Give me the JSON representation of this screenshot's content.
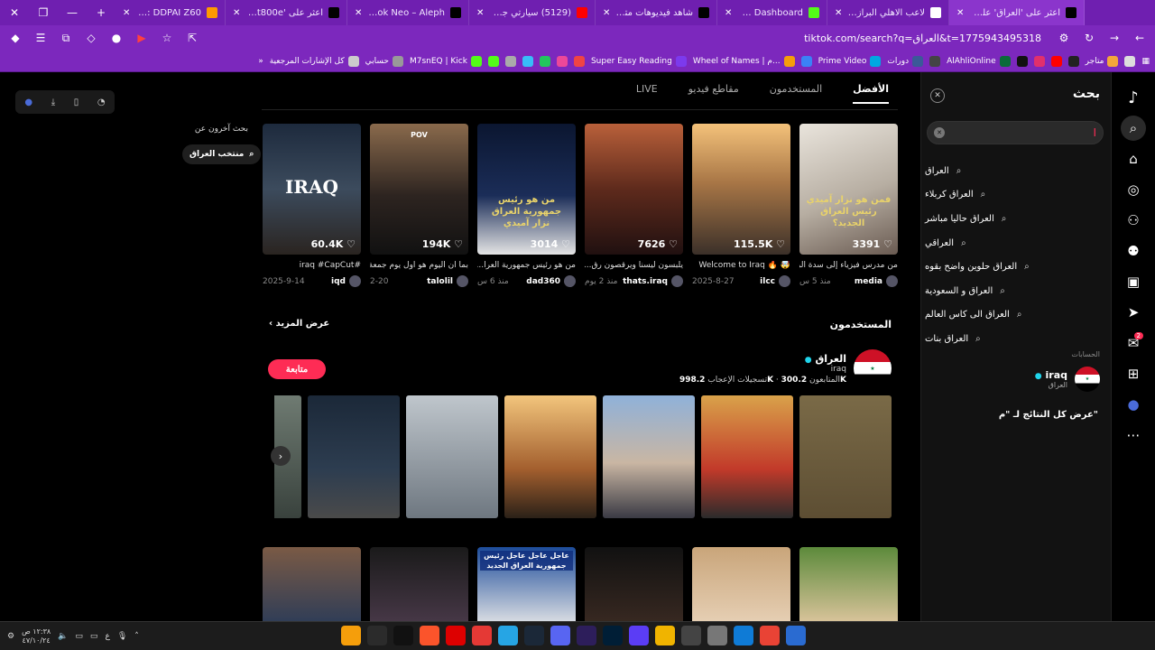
{
  "browser": {
    "tabs": [
      {
        "title": "Amazon.sa : DDPAI Z60",
        "fav": "#ff9900",
        "active": false
      },
      {
        "title": "اعثر على '70mai t800e'",
        "fav": "#010101",
        "active": false
      },
      {
        "title": "MacBook Neo – Aleph ف",
        "fav": "#000000",
        "active": false
      },
      {
        "title": "(5129) سيارتي جديدة!!😍",
        "fav": "#ff0000",
        "active": false
      },
      {
        "title": "شاهد فيديوهات متصدرة |",
        "fav": "#010101",
        "active": false
      },
      {
        "title": "VODs - Kick Dashboard",
        "fav": "#53fc18",
        "active": false
      },
      {
        "title": "لاعب الاهلي البرازيلي السا",
        "fav": "#ffffff",
        "active": false
      },
      {
        "title": "اعثر على 'العراق' على TikTok",
        "fav": "#010101",
        "active": true
      }
    ],
    "url": "tiktok.com/search?q=العراق&t=1775943495318",
    "bookmarks": [
      {
        "label": "",
        "color": "#dddddd"
      },
      {
        "label": "متاجر",
        "color": "#f4a63a"
      },
      {
        "label": "",
        "color": "#222222"
      },
      {
        "label": "",
        "color": "#ff0000"
      },
      {
        "label": "",
        "color": "#e1306c"
      },
      {
        "label": "",
        "color": "#111111"
      },
      {
        "label": "AlAhliOnline",
        "color": "#0a6b3a"
      },
      {
        "label": "",
        "color": "#444444"
      },
      {
        "label": "دورات",
        "color": "#3b5998"
      },
      {
        "label": "Prime Video",
        "color": "#00a8e1"
      },
      {
        "label": "",
        "color": "#3b82f6"
      },
      {
        "label": "Wheel of Names | م...",
        "color": "#f59e0b"
      },
      {
        "label": "Super Easy Reading",
        "color": "#7c3aed"
      },
      {
        "label": "",
        "color": "#ef4444"
      },
      {
        "label": "",
        "color": "#ec4899"
      },
      {
        "label": "",
        "color": "#22c55e"
      },
      {
        "label": "",
        "color": "#38bdf8"
      },
      {
        "label": "",
        "color": "#aaaaaa"
      },
      {
        "label": "",
        "color": "#53fc18"
      },
      {
        "label": "M7snEQ | Kick",
        "color": "#53fc18"
      },
      {
        "label": "حسابي",
        "color": "#999999"
      },
      {
        "label": "كل الإشارات المرجعية",
        "color": "#cccccc"
      }
    ]
  },
  "rail": {
    "inbox_badge": "2"
  },
  "search_panel": {
    "title": "بحث",
    "input_value": "",
    "suggestions": [
      "العراق",
      "العراق كربلاء",
      "العراق حاليا مباشر",
      "العراقي",
      "العراق حلوين واضح بقوه",
      "العراق و السعودية",
      "العراق الى كاس العالم",
      "العراق بنات"
    ],
    "accounts_label": "الحسابات",
    "account": {
      "name": "iraq",
      "sub": "العراق"
    },
    "view_all": "عرض كل النتائج لـ \"م\""
  },
  "main": {
    "tabs": [
      "الأفضل",
      "المستخدمون",
      "مقاطع فيديو",
      "LIVE"
    ],
    "videos": [
      {
        "likes": "3391",
        "caption": "فمن هو نزار آميدي رئيس العراق الجديد؟",
        "desc": "من مدرس فيزياء إلى سدة الر...",
        "author": "media",
        "date": "منذ 5 س",
        "bg": "linear-gradient(160deg,#e9e4dc,#b7aea2 55%,#6a5b52)"
      },
      {
        "likes": "115.5K",
        "caption": "",
        "desc": "🤯 🔥 Welcome to Iraq",
        "author": "ilcc",
        "date": "2025-8-27",
        "bg": "linear-gradient(180deg,#f4c27a,#a87646 45%,#3b3029)"
      },
      {
        "likes": "7626",
        "caption": "",
        "desc": "يلبسون ليسنا ويرقصون رق...",
        "author": "thats.iraq",
        "date": "منذ 2 يوم",
        "bg": "linear-gradient(180deg,#b9603a,#5e2a1c 50%,#201010)"
      },
      {
        "likes": "3014",
        "caption": "من هو رئيس جمهورية العراق نزار آميدي",
        "desc": "من هو رئيس جمهورية العرا...",
        "author": "dad360",
        "date": "منذ 6 س",
        "bg": "linear-gradient(180deg,#0b1630,#1b2d58 55%,#e5e5e5)"
      },
      {
        "likes": "194K",
        "caption": "POV",
        "desc": "بما ان اليوم هو اول يوم جمعة...",
        "author": "talolil",
        "date": "2-20",
        "bg": "linear-gradient(180deg,#8a6a4c,#2d2420 55%,#111)"
      },
      {
        "likes": "60.4K",
        "caption": "IRAQ",
        "desc": "#iraq #CapCut",
        "author": "iqd",
        "date": "2025-9-14",
        "bg": "linear-gradient(180deg,#1d2a3d,#3c4b5d 50%,#2a2420)"
      }
    ],
    "users_heading": "المستخدمون",
    "users_more": "عرض المزيد",
    "user": {
      "name": "العراق",
      "handle": "iraq",
      "followers": "300.2K",
      "followers_label": "المتابعون",
      "likes": "998.2K",
      "likes_label": "تسجيلات الإعجاب",
      "follow_label": "متابعة"
    },
    "user_thumbs": [
      "linear-gradient(180deg,#7a6a47,#5d4e33)",
      "linear-gradient(180deg,#d9a24a,#c23a2a 60%,#2b2b2b)",
      "linear-gradient(180deg,#8fb1d9,#c9b6a3 55%,#3a3a44)",
      "linear-gradient(180deg,#f2c57c,#a35f2e 60%,#2b2118)",
      "linear-gradient(180deg,#bfc6cc,#6e7780)",
      "linear-gradient(180deg,#1b2838,#2d3d50 60%,#4a4a4a)",
      "linear-gradient(180deg,#6f7b72,#39423d)"
    ],
    "row3": [
      "linear-gradient(180deg,#5c8a3b,#e3c8a2)",
      "linear-gradient(180deg,#c9a57a,#e8d2b8)",
      "linear-gradient(180deg,#111,#3a2a22)",
      "linear-gradient(180deg,#1d4c9a,#e8e8e8)",
      "linear-gradient(180deg,#1a1a1a,#4a3a4a)",
      "linear-gradient(180deg,#7a5a45,#2a3b58)"
    ],
    "row3_caption": "عاجل عاجل عاجل رئيس جمهورية العراق الجديد"
  },
  "left": {
    "others_title": "بحث آخرون عن",
    "chip": "منتخب العراق"
  },
  "taskbar": {
    "clock_time": "١٢:٣٨ ص",
    "clock_date": "٤٧/١٠/٢٤",
    "lang": "ع",
    "apps": [
      "#f59e0b",
      "#2b2b2b",
      "#111",
      "#fb542b",
      "#d00",
      "#e53935",
      "#26a5e4",
      "#1b2838",
      "#5865f2",
      "#2d1e5b",
      "#001e36",
      "#5b3df5",
      "#f0b400",
      "#444",
      "#777",
      "#0f7bd6",
      "#e94335",
      "#2a6bd1"
    ]
  }
}
